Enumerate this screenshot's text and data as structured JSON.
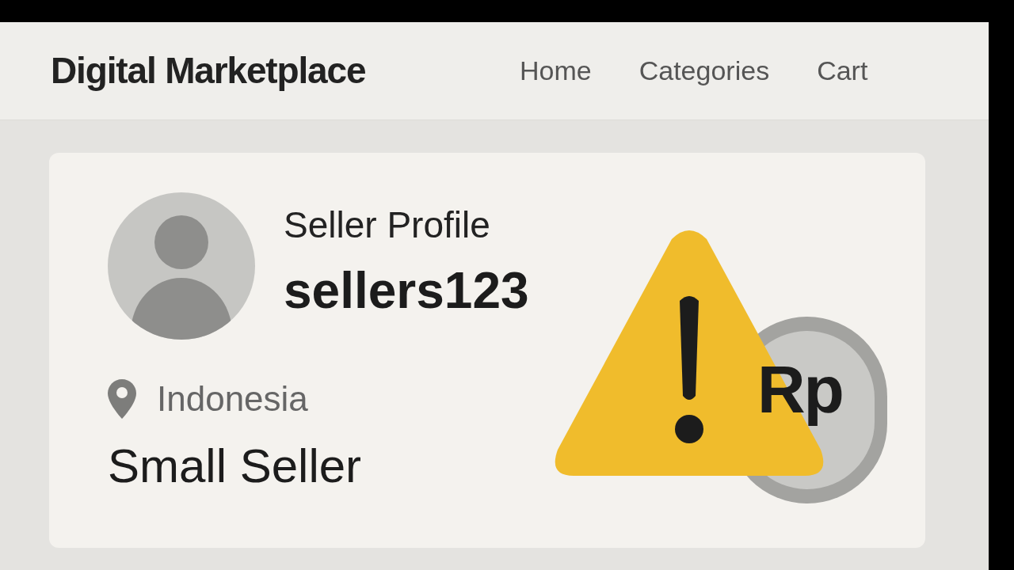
{
  "header": {
    "title": "Digital Marketplace",
    "nav": [
      {
        "label": "Home"
      },
      {
        "label": "Categories"
      },
      {
        "label": "Cart"
      }
    ]
  },
  "profile": {
    "heading": "Seller Profile",
    "username": "sellers123",
    "location": "Indonesia",
    "tier": "Small Seller"
  },
  "illustration": {
    "coin_label": "Rp"
  }
}
